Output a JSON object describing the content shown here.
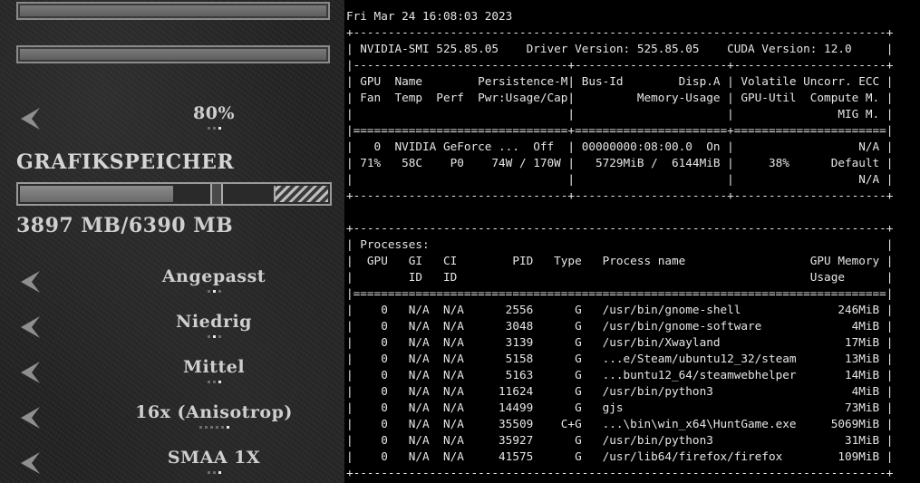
{
  "game": {
    "percent_label": "80%",
    "memory_title": "GRAFIKSPEICHER",
    "memory_value": "3897 MB/6390 MB",
    "memory_used_mb": 3897,
    "memory_total_mb": 6390,
    "options": [
      {
        "value": "Angepasst",
        "dots": 3,
        "active": 1
      },
      {
        "value": "Niedrig",
        "dots": 3,
        "active": 1
      },
      {
        "value": "Mittel",
        "dots": 3,
        "active": 2
      },
      {
        "value": "16x (Anisotrop)",
        "dots": 6,
        "active": 5
      },
      {
        "value": "SMAA 1X",
        "dots": 3,
        "active": 2
      }
    ],
    "percent_dots": 3,
    "percent_active": 2
  },
  "terminal": {
    "lines": [
      "Fri Mar 24 16:08:03 2023",
      "+-----------------------------------------------------------------------------+",
      "| NVIDIA-SMI 525.85.05    Driver Version: 525.85.05    CUDA Version: 12.0     |",
      "|-------------------------------+----------------------+----------------------+",
      "| GPU  Name        Persistence-M| Bus-Id        Disp.A | Volatile Uncorr. ECC |",
      "| Fan  Temp  Perf  Pwr:Usage/Cap|         Memory-Usage | GPU-Util  Compute M. |",
      "|                               |                      |               MIG M. |",
      "|===============================+======================+======================|",
      "|   0  NVIDIA GeForce ...  Off  | 00000000:08:00.0  On |                  N/A |",
      "| 71%   58C    P0    74W / 170W |   5729MiB /  6144MiB |     38%      Default |",
      "|                               |                      |                  N/A |",
      "+-------------------------------+----------------------+----------------------+",
      "",
      "+-----------------------------------------------------------------------------+",
      "| Processes:                                                                  |",
      "|  GPU   GI   CI        PID   Type   Process name                  GPU Memory |",
      "|        ID   ID                                                   Usage      |",
      "|=============================================================================|",
      "|    0   N/A  N/A      2556      G   /usr/bin/gnome-shell              246MiB |",
      "|    0   N/A  N/A      3048      G   /usr/bin/gnome-software             4MiB |",
      "|    0   N/A  N/A      3139      G   /usr/bin/Xwayland                  17MiB |",
      "|    0   N/A  N/A      5158      G   ...e/Steam/ubuntu12_32/steam       13MiB |",
      "|    0   N/A  N/A      5163      G   ...buntu12_64/steamwebhelper       14MiB |",
      "|    0   N/A  N/A     11624      G   /usr/bin/python3                    4MiB |",
      "|    0   N/A  N/A     14499      G   gjs                                73MiB |",
      "|    0   N/A  N/A     35509    C+G   ...\\bin\\win_x64\\HuntGame.exe     5069MiB |",
      "|    0   N/A  N/A     35927      G   /usr/bin/python3                   31MiB |",
      "|    0   N/A  N/A     41575      G   /usr/lib64/firefox/firefox        109MiB |",
      "+-----------------------------------------------------------------------------+"
    ]
  }
}
